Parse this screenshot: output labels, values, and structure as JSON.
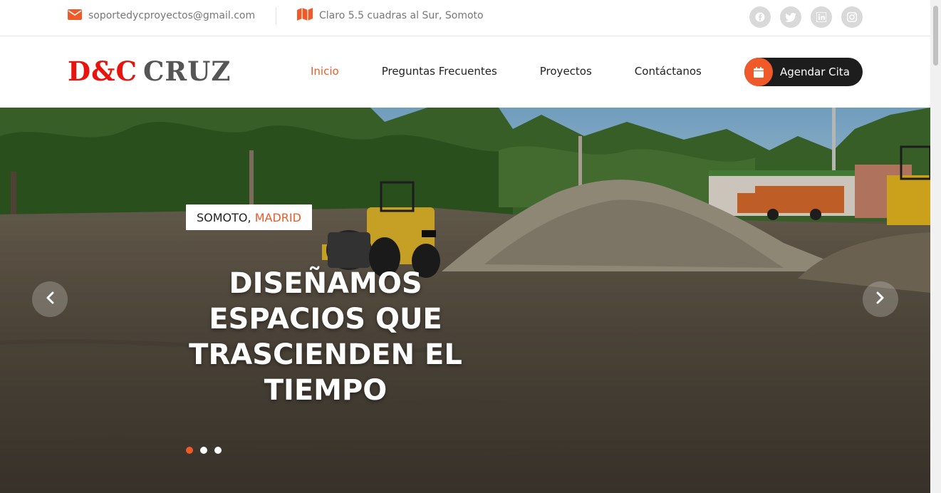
{
  "topbar": {
    "email": "soportedycproyectos@gmail.com",
    "address": "Claro 5.5 cuadras al Sur, Somoto",
    "socials": [
      "facebook-icon",
      "twitter-icon",
      "linkedin-icon",
      "instagram-icon"
    ]
  },
  "logo": {
    "part1": "D&C",
    "part2": "CRUZ"
  },
  "nav": {
    "items": [
      "Inicio",
      "Preguntas Frecuentes",
      "Proyectos",
      "Contáctanos"
    ],
    "active": "Inicio"
  },
  "cta": {
    "label": "Agendar Cita",
    "icon": "calendar-icon"
  },
  "hero": {
    "location_city": "SOMOTO,",
    "location_region": "MADRID",
    "title_lines": [
      "DISEÑAMOS",
      "ESPACIOS QUE",
      "TRASCIENDEN EL",
      "TIEMPO"
    ],
    "slide_count": 3,
    "active_slide": 1
  },
  "colors": {
    "accent": "#f05a28",
    "logo_red": "#e8130f",
    "logo_gray": "#555555",
    "dark": "#1d1d1d"
  }
}
